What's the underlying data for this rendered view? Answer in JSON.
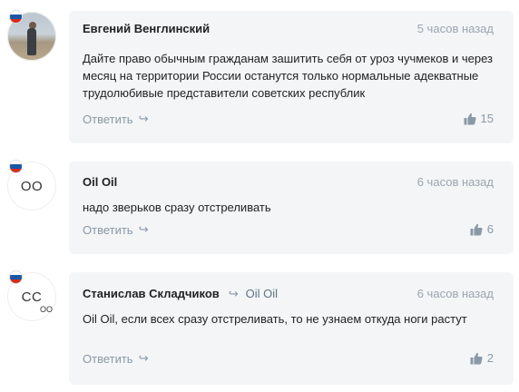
{
  "comments": [
    {
      "author": "Евгений Венглинский",
      "time": "5 часов назад",
      "text": "Дайте право обычным гражданам зашитить себя от уроз чучмеков и через месяц на территории России останутся только нормальные адекватные трудолюбивые представители советских республик",
      "reply_label": "Ответить",
      "likes": "15"
    },
    {
      "avatar_initials": "OO",
      "author": "Oil Oil",
      "time": "6 часов назад",
      "text": "надо зверьков сразу отстреливать",
      "reply_label": "Ответить",
      "likes": "6"
    },
    {
      "avatar_initials": "CC",
      "avatar_sub_initials": "OO",
      "author": "Станислав Складчиков",
      "reply_to": "Oil Oil",
      "time": "6 часов назад",
      "text": "Oil Oil, если всех сразу отстреливать, то не узнаем откуда ноги растут",
      "reply_label": "Ответить",
      "likes": "2"
    }
  ]
}
